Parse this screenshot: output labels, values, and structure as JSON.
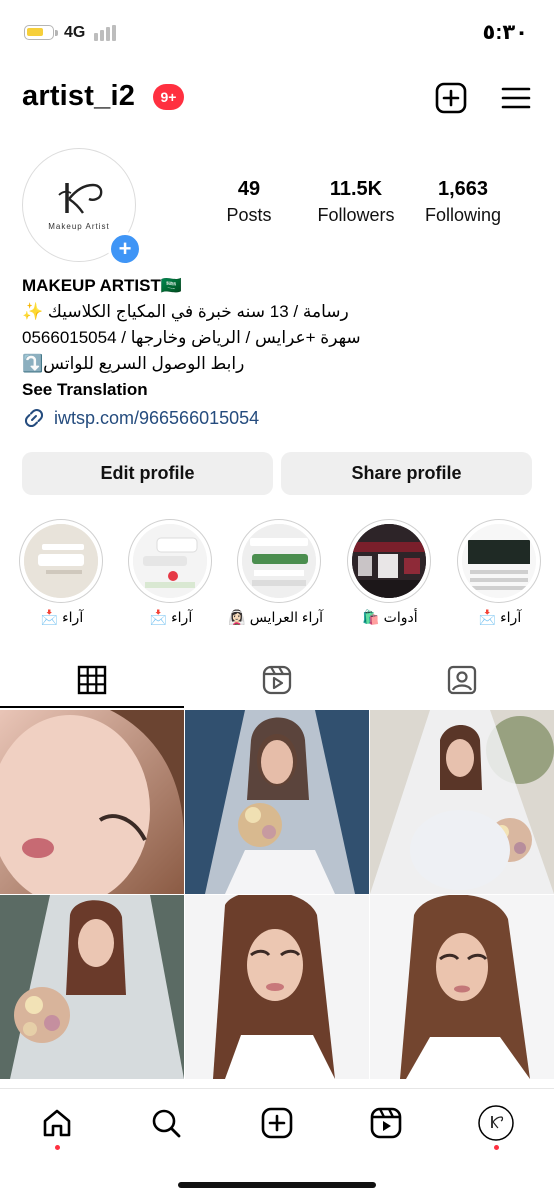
{
  "status_bar": {
    "network": "4G",
    "time": "٥:٣٠"
  },
  "header": {
    "username": "artist_i2",
    "notification_badge": "9+",
    "icons": [
      "plus-square-icon",
      "menu-icon"
    ]
  },
  "profile": {
    "avatar_caption": "Makeup Artist",
    "stats": [
      {
        "value": "49",
        "label": "Posts"
      },
      {
        "value": "11.5K",
        "label": "Followers"
      },
      {
        "value": "1,663",
        "label": "Following"
      }
    ],
    "bio": {
      "name": "MAKEUP ARTIST",
      "flag": "🇸🇦",
      "line1": "رسامة / 13 سنه خبرة في المكياج الكلاسيك ✨",
      "line2": "سهرة +عرايس / الرياض وخارجها / 0566015054",
      "line3": "رابط الوصول السريع للواتس⤵️",
      "see_translation": "See Translation"
    },
    "link": "iwtsp.com/966566015054"
  },
  "buttons": {
    "edit": "Edit profile",
    "share": "Share profile"
  },
  "highlights": [
    {
      "label": "آراء 📩"
    },
    {
      "label": "آراء 📩"
    },
    {
      "label": "آراء العرايس 👰🏻‍♀️"
    },
    {
      "label": "أدوات 🛍️"
    },
    {
      "label": "آراء 📩"
    }
  ],
  "tabs": [
    "grid-icon",
    "reels-icon",
    "tagged-icon"
  ],
  "grid_posts": [
    {
      "subject": "close-up makeup"
    },
    {
      "subject": "bride with bouquet"
    },
    {
      "subject": "bride in veil"
    },
    {
      "subject": "bride with bouquet"
    },
    {
      "subject": "bridal look"
    },
    {
      "subject": "bridal look"
    }
  ],
  "bottom_nav": [
    "home-icon",
    "search-icon",
    "create-icon",
    "reels-icon",
    "profile-icon"
  ],
  "colors": {
    "badge": "#ff3040",
    "link": "#254c7e",
    "button_bg": "#efefef",
    "add_avatar": "#3f95f6"
  }
}
